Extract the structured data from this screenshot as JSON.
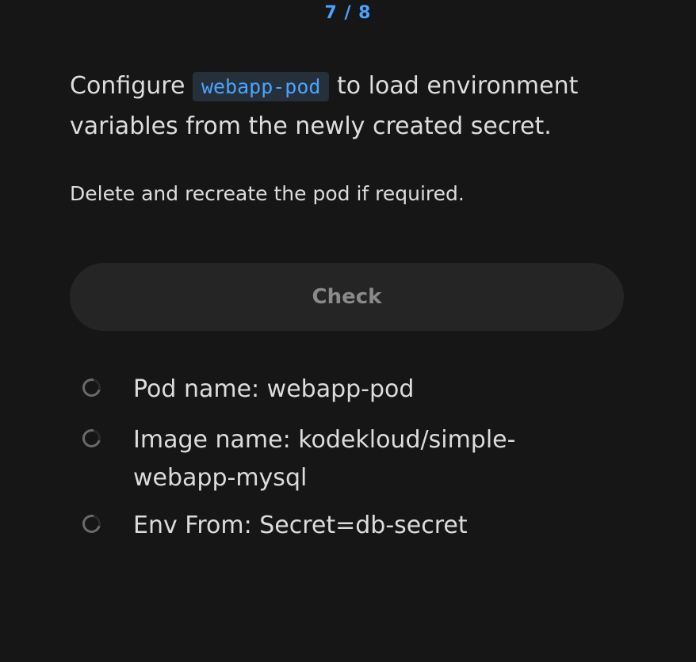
{
  "progress": "7 / 8",
  "question": {
    "prefix": "Configure",
    "code": "webapp-pod",
    "suffix": "to load environment variables from the newly created secret."
  },
  "subtext": "Delete and recreate the pod if required.",
  "check_label": "Check",
  "criteria": [
    {
      "label": "Pod name: webapp-pod",
      "status": "pending"
    },
    {
      "label": "Image name: kodekloud/simple-webapp-mysql",
      "status": "pending"
    },
    {
      "label": "Env From: Secret=db-secret",
      "status": "pending"
    }
  ]
}
